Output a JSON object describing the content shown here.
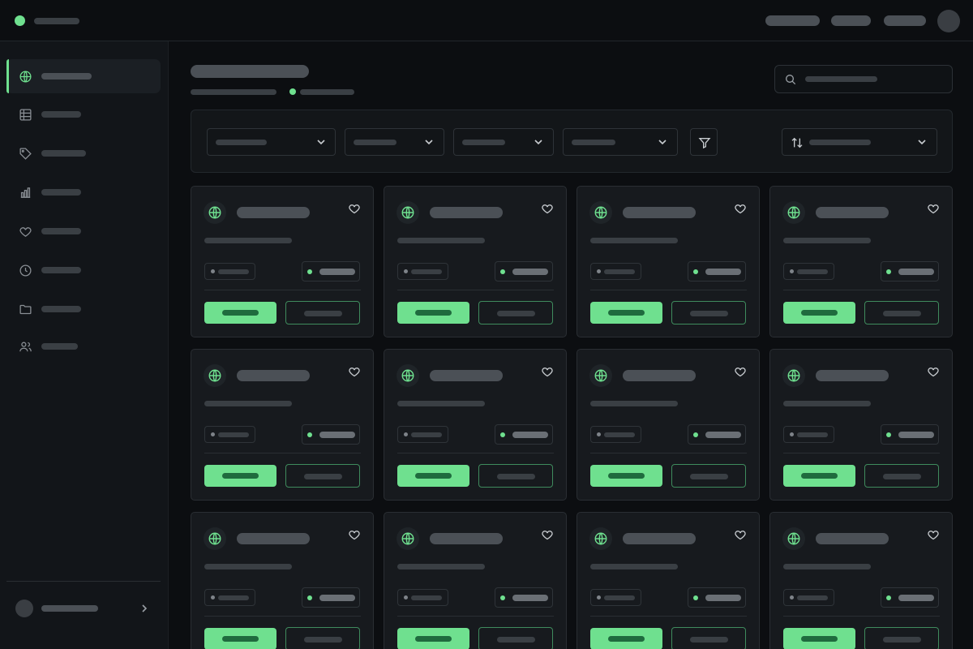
{
  "theme": {
    "accent": "#6fe08f",
    "accent_dark": "#1f6b3e",
    "background": "#0c0e11",
    "sidebar_bg": "#121519",
    "card_bg": "#171a1e"
  },
  "topbar": {
    "brand_icon": "status-dot",
    "nav_links": [
      "",
      "",
      ""
    ],
    "avatar": "user-avatar"
  },
  "sidebar": {
    "items": [
      {
        "icon": "globe-icon",
        "label": "",
        "active": true
      },
      {
        "icon": "table-icon",
        "label": "",
        "active": false
      },
      {
        "icon": "tag-icon",
        "label": "",
        "active": false
      },
      {
        "icon": "bar-chart-icon",
        "label": "",
        "active": false
      },
      {
        "icon": "heart-icon",
        "label": "",
        "active": false
      },
      {
        "icon": "clock-icon",
        "label": "",
        "active": false
      },
      {
        "icon": "folder-icon",
        "label": "",
        "active": false
      },
      {
        "icon": "users-icon",
        "label": "",
        "active": false
      }
    ],
    "user": {
      "name": "",
      "chevron": "chevron-right-icon"
    }
  },
  "header": {
    "title": "",
    "subtitle": "",
    "status": ""
  },
  "search": {
    "placeholder": "",
    "icon": "search-icon"
  },
  "filters": {
    "selects": [
      "",
      "",
      "",
      ""
    ],
    "filter_icon": "filter-icon",
    "sort": {
      "label": "",
      "icon": "sort-icon"
    }
  },
  "cards": [
    {
      "icon": "globe-icon",
      "title": "",
      "description": "",
      "tag": "",
      "status": "",
      "primary_action": "",
      "secondary_action": ""
    },
    {
      "icon": "globe-icon",
      "title": "",
      "description": "",
      "tag": "",
      "status": "",
      "primary_action": "",
      "secondary_action": ""
    },
    {
      "icon": "globe-icon",
      "title": "",
      "description": "",
      "tag": "",
      "status": "",
      "primary_action": "",
      "secondary_action": ""
    },
    {
      "icon": "globe-icon",
      "title": "",
      "description": "",
      "tag": "",
      "status": "",
      "primary_action": "",
      "secondary_action": ""
    },
    {
      "icon": "globe-icon",
      "title": "",
      "description": "",
      "tag": "",
      "status": "",
      "primary_action": "",
      "secondary_action": ""
    },
    {
      "icon": "globe-icon",
      "title": "",
      "description": "",
      "tag": "",
      "status": "",
      "primary_action": "",
      "secondary_action": ""
    },
    {
      "icon": "globe-icon",
      "title": "",
      "description": "",
      "tag": "",
      "status": "",
      "primary_action": "",
      "secondary_action": ""
    },
    {
      "icon": "globe-icon",
      "title": "",
      "description": "",
      "tag": "",
      "status": "",
      "primary_action": "",
      "secondary_action": ""
    },
    {
      "icon": "globe-icon",
      "title": "",
      "description": "",
      "tag": "",
      "status": "",
      "primary_action": "",
      "secondary_action": ""
    },
    {
      "icon": "globe-icon",
      "title": "",
      "description": "",
      "tag": "",
      "status": "",
      "primary_action": "",
      "secondary_action": ""
    },
    {
      "icon": "globe-icon",
      "title": "",
      "description": "",
      "tag": "",
      "status": "",
      "primary_action": "",
      "secondary_action": ""
    },
    {
      "icon": "globe-icon",
      "title": "",
      "description": "",
      "tag": "",
      "status": "",
      "primary_action": "",
      "secondary_action": ""
    }
  ]
}
